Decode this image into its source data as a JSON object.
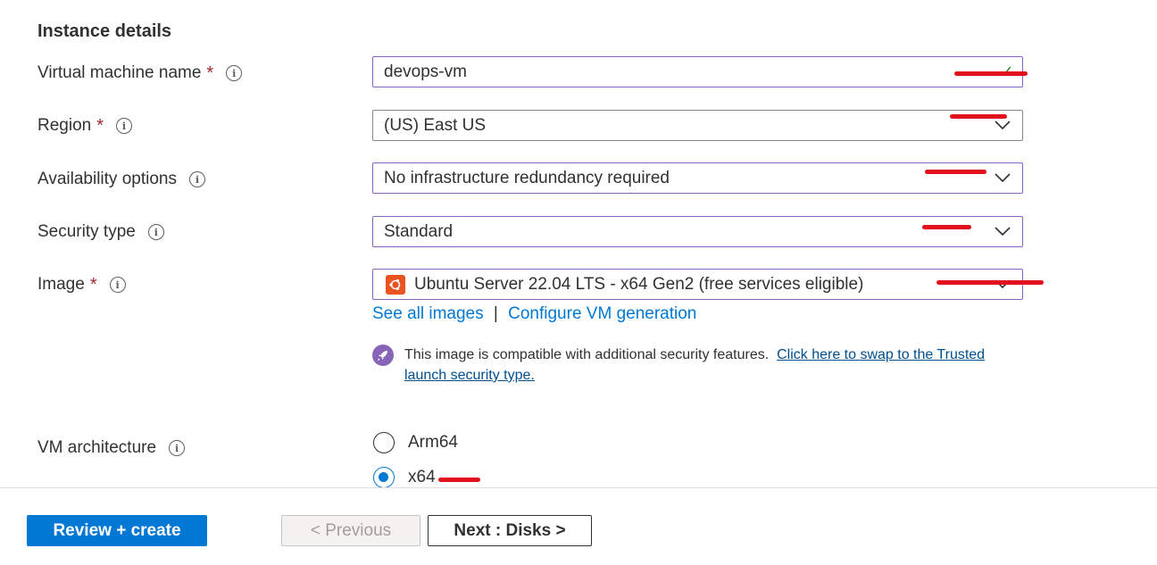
{
  "section_title": "Instance details",
  "fields": {
    "vm_name": {
      "label": "Virtual machine name",
      "required": "*",
      "value": "devops-vm"
    },
    "region": {
      "label": "Region",
      "required": "*",
      "value": "(US) East US"
    },
    "availability": {
      "label": "Availability options",
      "value": "No infrastructure redundancy required"
    },
    "security_type": {
      "label": "Security type",
      "value": "Standard"
    },
    "image": {
      "label": "Image",
      "required": "*",
      "value": "Ubuntu Server 22.04 LTS - x64 Gen2 (free services eligible)"
    }
  },
  "info_icon": "i",
  "image_links": {
    "see_all": "See all images",
    "separator": "|",
    "configure": "Configure VM generation"
  },
  "note": {
    "text": "This image is compatible with additional security features.",
    "link": "Click here to swap to the Trusted launch security type."
  },
  "architecture": {
    "label": "VM architecture",
    "options": [
      {
        "label": "Arm64",
        "checked": false
      },
      {
        "label": "x64",
        "checked": true
      }
    ]
  },
  "footer": {
    "review_create": "Review + create",
    "previous": "< Previous",
    "next": "Next : Disks >"
  },
  "colors": {
    "accent": "#0078d4",
    "focus_border": "#8764b8",
    "required": "#a4262c",
    "annotation_red": "#e3101d",
    "ubuntu_orange": "#e95420"
  },
  "icons": {
    "info": "info-circle-icon",
    "chevron": "chevron-down-icon",
    "valid": "checkmark-icon",
    "ubuntu": "ubuntu-logo-icon",
    "rocket": "rocket-icon"
  }
}
